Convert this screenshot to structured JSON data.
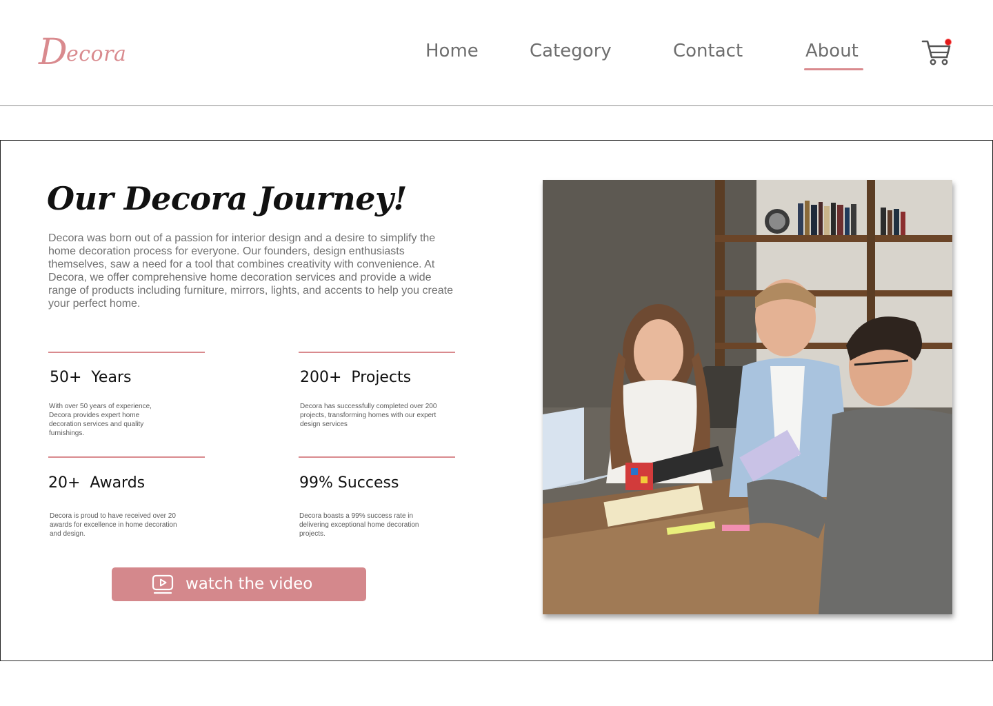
{
  "header": {
    "logo_text": "Decora",
    "logo_initial": "D",
    "logo_rest": "ecora",
    "nav": [
      {
        "label": "Home"
      },
      {
        "label": "Category"
      },
      {
        "label": "Contact"
      },
      {
        "label": "About",
        "active": true
      }
    ],
    "cart_icon": "shopping-cart-icon",
    "cart_badge": "notification-dot"
  },
  "about": {
    "title": "Our Decora Journey!",
    "intro": "Decora was born out of a passion for interior design and a desire to simplify the home decoration process for everyone. Our founders, design enthusiasts themselves, saw a need for a tool that combines creativity with convenience. At Decora, we offer comprehensive home decoration services and provide a wide range of products including furniture, mirrors, lights, and accents to help you create your perfect home.",
    "stats": [
      {
        "title": "50+  Years",
        "desc": "With over 50 years of experience, Decora provides expert home decoration services and quality furnishings."
      },
      {
        "title": "200+  Projects",
        "desc": "Decora has successfully completed over 200 projects, transforming homes with our expert design services"
      },
      {
        "title": "20+  Awards",
        "desc": "Decora is proud to have received over 20 awards for excellence in home decoration and design."
      },
      {
        "title": "99% Success",
        "desc": "Decora boasts a 99% success rate in delivering exceptional home decoration projects."
      }
    ],
    "video_button": {
      "label": "watch the video",
      "icon": "play-video-icon"
    }
  },
  "colors": {
    "accent": "#d98a8e",
    "button": "#d4888c",
    "nav_text": "#6e6e6e",
    "body_text": "#707070"
  }
}
